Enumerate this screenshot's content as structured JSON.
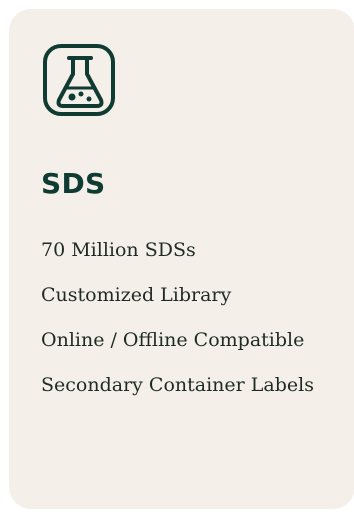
{
  "card": {
    "icon": "flask-icon",
    "title": "SDS",
    "features": [
      "70 Million SDSs",
      "Customized Library",
      "Online / Offline Compatible",
      "Secondary Container Labels"
    ]
  },
  "colors": {
    "card_background": "#f4f0e9",
    "accent": "#0f3b32",
    "text": "#1f2a27"
  }
}
